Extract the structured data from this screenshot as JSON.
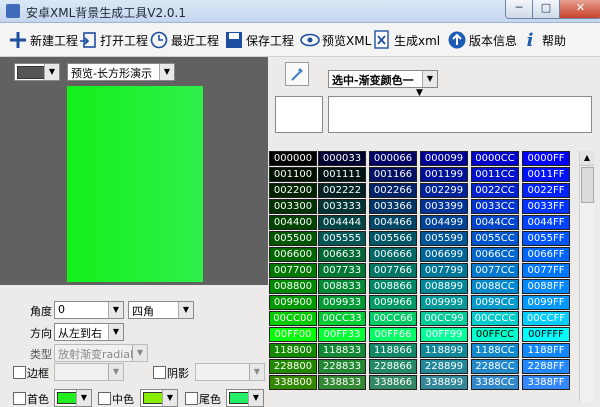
{
  "window": {
    "title": "安卓XML背景生成工具V2.0.1",
    "min": "─",
    "max": "□",
    "close": "✕"
  },
  "toolbar": {
    "new_project": "新建工程",
    "open_project": "打开工程",
    "recent_project": "最近工程",
    "save_project": "保存工程",
    "preview_xml": "预览XML",
    "generate_xml": "生成xml",
    "version_info": "版本信息",
    "help": "帮助"
  },
  "preview": {
    "mode_value": "预览-长方形演示",
    "gradient_start": "#14f01a",
    "gradient_end": "#2ef04a"
  },
  "controls": {
    "angle_label": "角度",
    "angle_value": "0",
    "corner_value": "四角",
    "direction_label": "方向",
    "direction_value": "从左到右",
    "type_label": "类型",
    "type_value": "放射渐变radial",
    "border_label": "边框",
    "shadow_label": "阴影",
    "first_color_label": "首色",
    "mid_color_label": "中色",
    "tail_color_label": "尾色",
    "first_color": "#22ee22",
    "mid_color": "#88ee00",
    "tail_color": "#22ee66"
  },
  "scheme": {
    "value": "选中-渐变颜色一",
    "marker": "▼"
  },
  "grid": {
    "rows": [
      [
        "000000",
        "000033",
        "000066",
        "000099",
        "0000CC",
        "0000FF"
      ],
      [
        "001100",
        "001111",
        "001166",
        "001199",
        "0011CC",
        "0011FF"
      ],
      [
        "002200",
        "002222",
        "002266",
        "002299",
        "0022CC",
        "0022FF"
      ],
      [
        "003300",
        "003333",
        "003366",
        "003399",
        "0033CC",
        "0033FF"
      ],
      [
        "004400",
        "004444",
        "004466",
        "004499",
        "0044CC",
        "0044FF"
      ],
      [
        "005500",
        "005555",
        "005566",
        "005599",
        "0055CC",
        "0055FF"
      ],
      [
        "006600",
        "006633",
        "006666",
        "006699",
        "0066CC",
        "0066FF"
      ],
      [
        "007700",
        "007733",
        "007766",
        "007799",
        "0077CC",
        "0077FF"
      ],
      [
        "008800",
        "008833",
        "008866",
        "008899",
        "0088CC",
        "0088FF"
      ],
      [
        "009900",
        "009933",
        "009966",
        "009999",
        "0099CC",
        "0099FF"
      ],
      [
        "00CC00",
        "00CC33",
        "00CC66",
        "00CC99",
        "00CCCC",
        "00CCFF"
      ],
      [
        "00FF00",
        "00FF33",
        "00FF66",
        "00FF99",
        "00FFCC",
        "00FFFF"
      ],
      [
        "118800",
        "118833",
        "118866",
        "118899",
        "1188CC",
        "1188FF"
      ],
      [
        "228800",
        "228833",
        "228866",
        "228899",
        "2288CC",
        "2288FF"
      ],
      [
        "338800",
        "338833",
        "338866",
        "338899",
        "3388CC",
        "3388FF"
      ]
    ]
  }
}
